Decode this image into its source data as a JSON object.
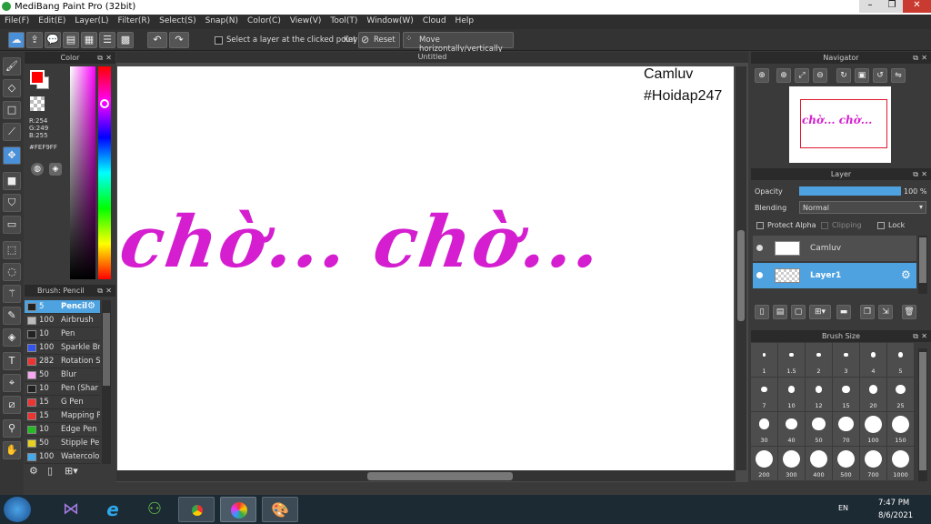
{
  "window": {
    "title": "MediBang Paint Pro (32bit)"
  },
  "menu": [
    "File(F)",
    "Edit(E)",
    "Layer(L)",
    "Filter(R)",
    "Select(S)",
    "Snap(N)",
    "Color(C)",
    "View(V)",
    "Tool(T)",
    "Window(W)",
    "Cloud",
    "Help"
  ],
  "toolbar": {
    "select_layer_label": "Select a layer at the clicked point",
    "key_label": "Key",
    "reset_label": "Reset",
    "move_label": "Move horizontally/vertically"
  },
  "color_panel": {
    "title": "Color",
    "r": "R:254",
    "g": "G:249",
    "b": "B:255",
    "hex": "#FEF9FF",
    "primary": "#ff0000",
    "secondary": "#ffffff"
  },
  "canvas": {
    "title": "Untitled",
    "text1": "Camluv",
    "text2": "#Hoidap247",
    "drawing_text": "chờ... chờ...",
    "ink": "#d41ecf"
  },
  "brush_panel": {
    "title": "Brush: Pencil",
    "items": [
      {
        "size": "5",
        "name": "Pencil",
        "color": "#222222",
        "selected": true
      },
      {
        "size": "100",
        "name": "Airbrush",
        "color": "#bbbbbb"
      },
      {
        "size": "10",
        "name": "Pen",
        "color": "#222222"
      },
      {
        "size": "100",
        "name": "Sparkle Br",
        "color": "#3355ee"
      },
      {
        "size": "282",
        "name": "Rotation S",
        "color": "#ee3333"
      },
      {
        "size": "50",
        "name": "Blur",
        "color": "#f7a8f0"
      },
      {
        "size": "10",
        "name": "Pen (Shar",
        "color": "#222222"
      },
      {
        "size": "15",
        "name": "G Pen",
        "color": "#ee3333"
      },
      {
        "size": "15",
        "name": "Mapping P",
        "color": "#ee3333"
      },
      {
        "size": "10",
        "name": "Edge Pen",
        "color": "#22bb22"
      },
      {
        "size": "50",
        "name": "Stipple Pe",
        "color": "#e8d020"
      },
      {
        "size": "100",
        "name": "Watercolo",
        "color": "#44aaee"
      }
    ]
  },
  "navigator": {
    "title": "Navigator"
  },
  "layer_panel": {
    "title": "Layer",
    "opacity_label": "Opacity",
    "opacity_value": "100 %",
    "opacity_fraction": 1.0,
    "blending_label": "Blending",
    "blending_value": "Normal",
    "protect_alpha": "Protect Alpha",
    "clipping": "Clipping",
    "lock": "Lock",
    "layers": [
      {
        "name": "Camluv",
        "selected": false
      },
      {
        "name": "Layer1",
        "selected": true
      }
    ]
  },
  "brush_size_panel": {
    "title": "Brush Size",
    "sizes": [
      "1",
      "1.5",
      "2",
      "3",
      "4",
      "5",
      "7",
      "10",
      "12",
      "15",
      "20",
      "25",
      "30",
      "40",
      "50",
      "70",
      "100",
      "150",
      "200",
      "300",
      "400",
      "500",
      "700",
      "1000"
    ]
  },
  "taskbar": {
    "time": "7:47 PM",
    "date": "8/6/2021",
    "lang": "EN"
  }
}
